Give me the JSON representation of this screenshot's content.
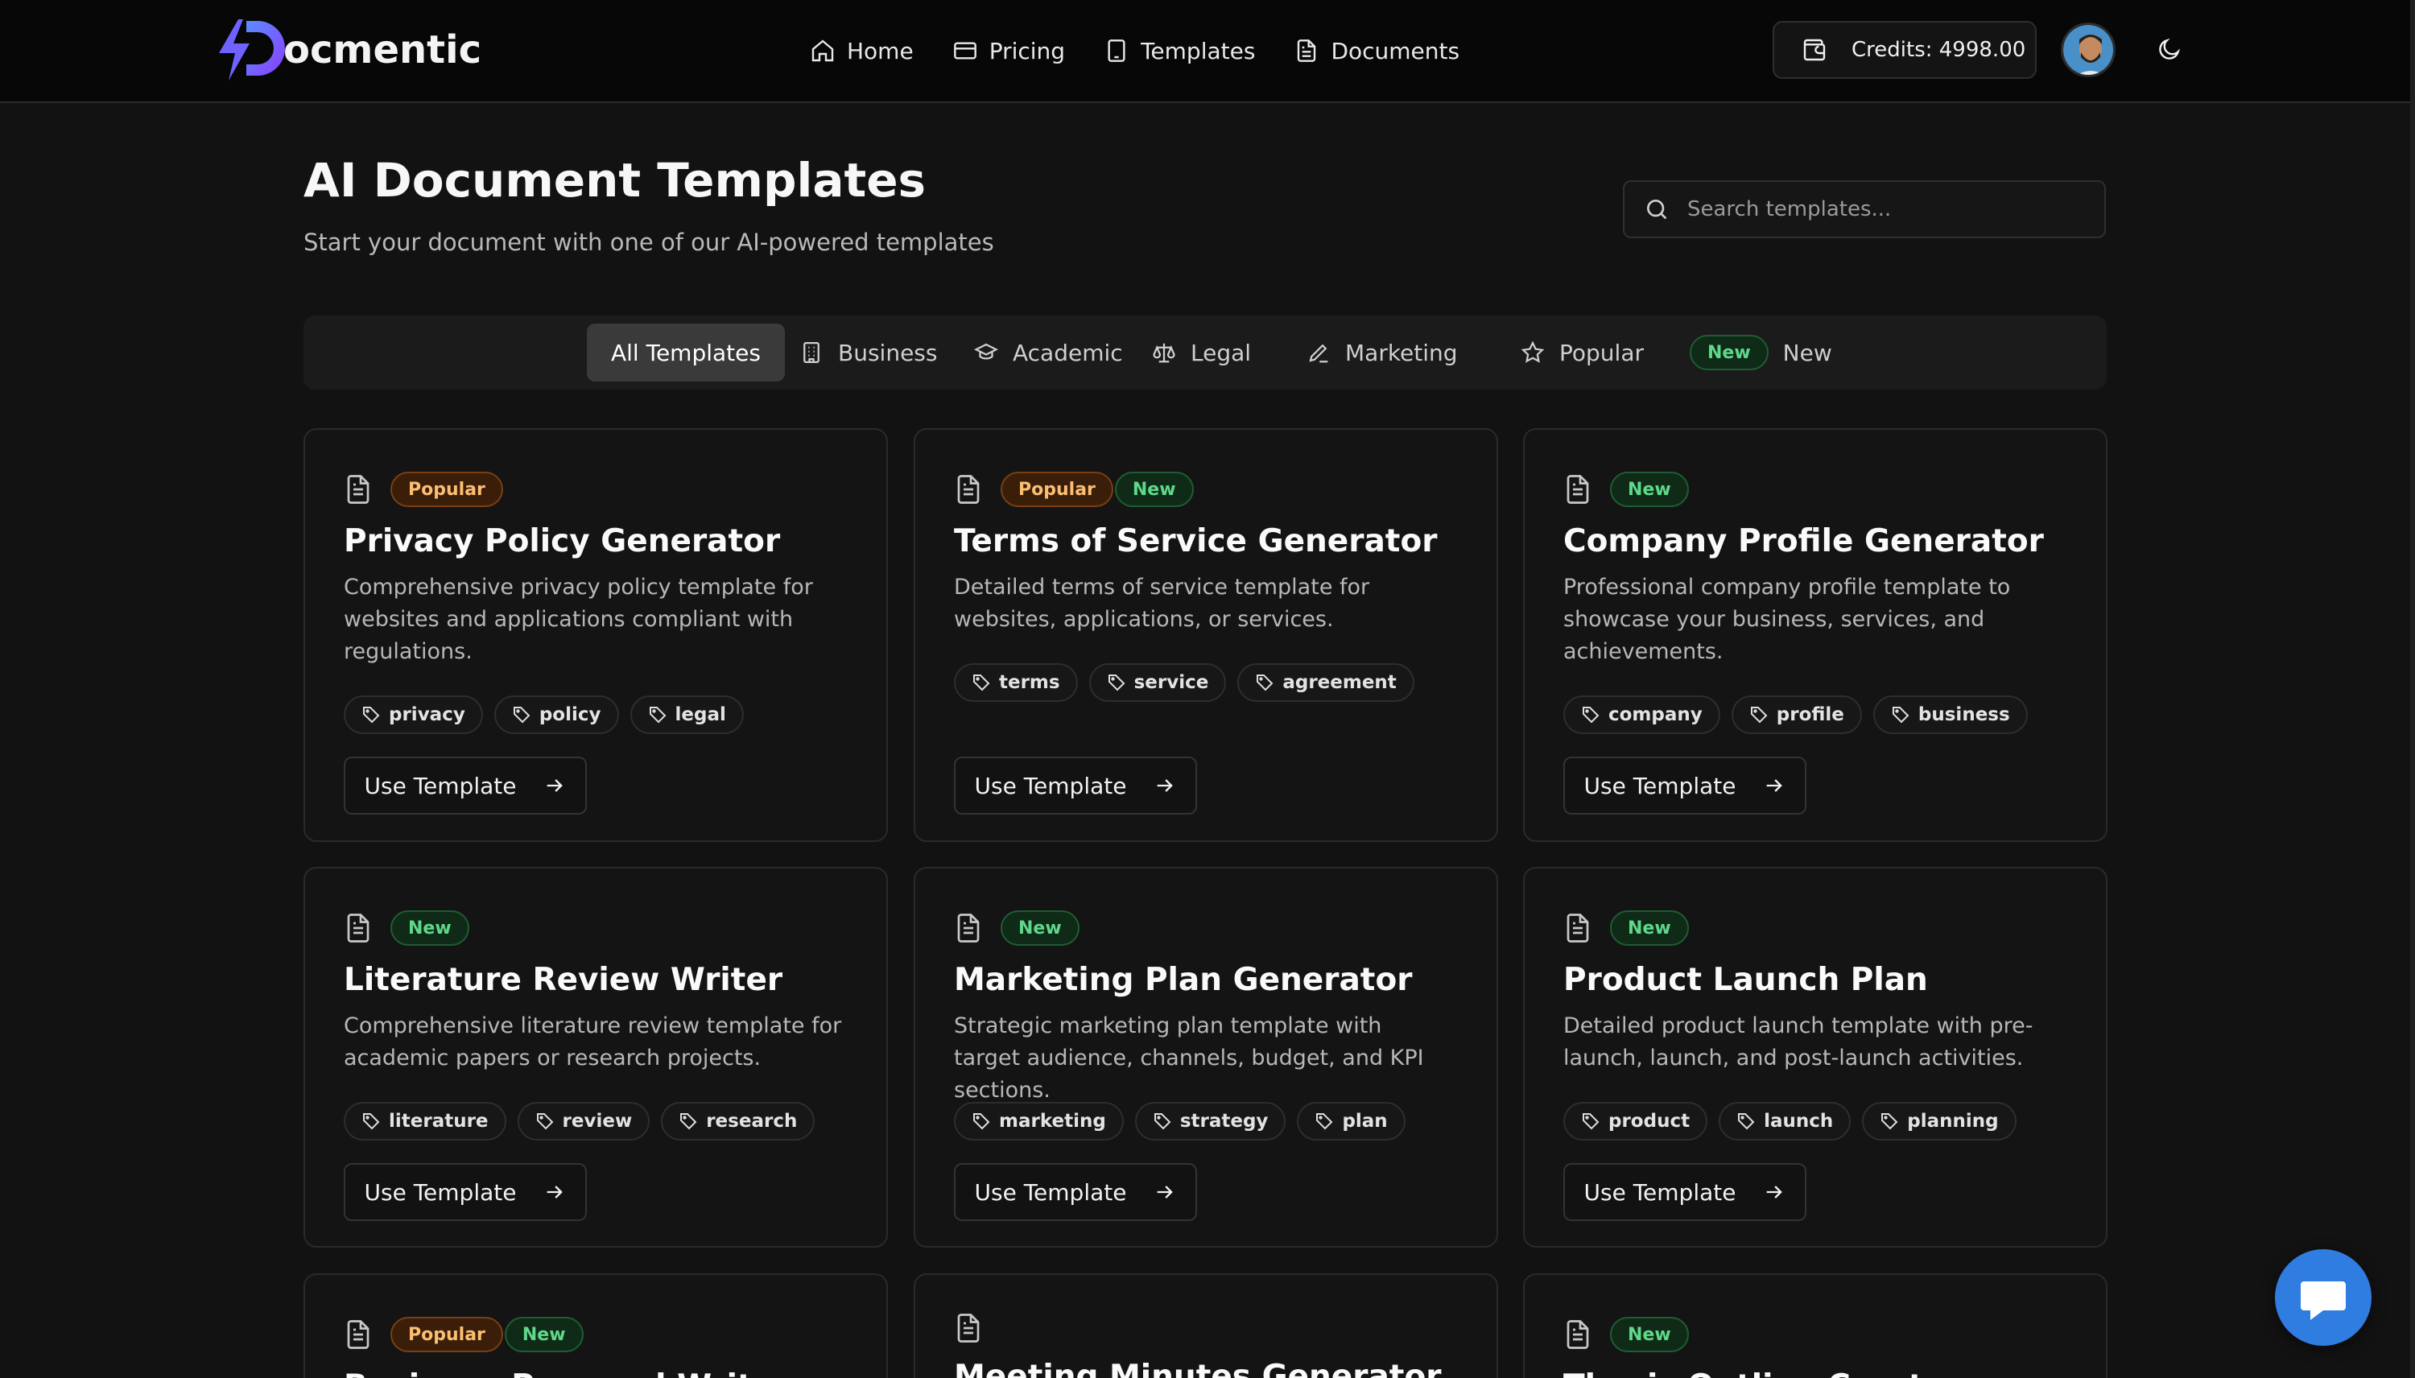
{
  "brand": {
    "name": "ocmentic"
  },
  "nav": {
    "items": [
      {
        "label": "Home",
        "icon": "home-icon"
      },
      {
        "label": "Pricing",
        "icon": "credit-card-icon"
      },
      {
        "label": "Templates",
        "icon": "tablet-icon"
      },
      {
        "label": "Documents",
        "icon": "file-text-icon"
      }
    ]
  },
  "header": {
    "credits_label": "Credits: 4998.00"
  },
  "page": {
    "title": "AI Document Templates",
    "subtitle": "Start your document with one of our AI-powered templates"
  },
  "search": {
    "placeholder": "Search templates..."
  },
  "tabs": [
    {
      "label": "All Templates",
      "active": true
    },
    {
      "label": "Business",
      "icon": "building-icon"
    },
    {
      "label": "Academic",
      "icon": "graduation-cap-icon"
    },
    {
      "label": "Legal",
      "icon": "scale-icon"
    },
    {
      "label": "Marketing",
      "icon": "pen-icon"
    },
    {
      "label": "Popular",
      "icon": "star-icon"
    },
    {
      "label": "New",
      "pill": "New"
    }
  ],
  "badges": {
    "popular": "Popular",
    "new": "New"
  },
  "cards": [
    {
      "title": "Privacy Policy Generator",
      "description": "Comprehensive privacy policy template for websites and applications compliant with regulations.",
      "badges": [
        "Popular"
      ],
      "tags": [
        "privacy",
        "policy",
        "legal"
      ],
      "button": "Use Template"
    },
    {
      "title": "Terms of Service Generator",
      "description": "Detailed terms of service template for websites, applications, or services.",
      "badges": [
        "Popular",
        "New"
      ],
      "tags": [
        "terms",
        "service",
        "agreement"
      ],
      "button": "Use Template"
    },
    {
      "title": "Company Profile Generator",
      "description": "Professional company profile template to showcase your business, services, and achievements.",
      "badges": [
        "New"
      ],
      "tags": [
        "company",
        "profile",
        "business"
      ],
      "button": "Use Template"
    },
    {
      "title": "Literature Review Writer",
      "description": "Comprehensive literature review template for academic papers or research projects.",
      "badges": [
        "New"
      ],
      "tags": [
        "literature",
        "review",
        "research"
      ],
      "button": "Use Template"
    },
    {
      "title": "Marketing Plan Generator",
      "description": "Strategic marketing plan template with target audience, channels, budget, and KPI sections.",
      "badges": [
        "New"
      ],
      "tags": [
        "marketing",
        "strategy",
        "plan"
      ],
      "button": "Use Template"
    },
    {
      "title": "Product Launch Plan",
      "description": "Detailed product launch template with pre-launch, launch, and post-launch activities.",
      "badges": [
        "New"
      ],
      "tags": [
        "product",
        "launch",
        "planning"
      ],
      "button": "Use Template"
    },
    {
      "title": "Business Proposal Writer",
      "badges": [
        "Popular",
        "New"
      ]
    },
    {
      "title": "Meeting Minutes Generator",
      "badges": []
    },
    {
      "title": "Thesis Outline Creator",
      "badges": [
        "New"
      ]
    }
  ],
  "colors": {
    "background": "#121212",
    "header": "#070707",
    "popular": "#fbbf73",
    "new": "#5fd88a",
    "chat": "#2f7de0",
    "logo": "#7c3aed"
  }
}
